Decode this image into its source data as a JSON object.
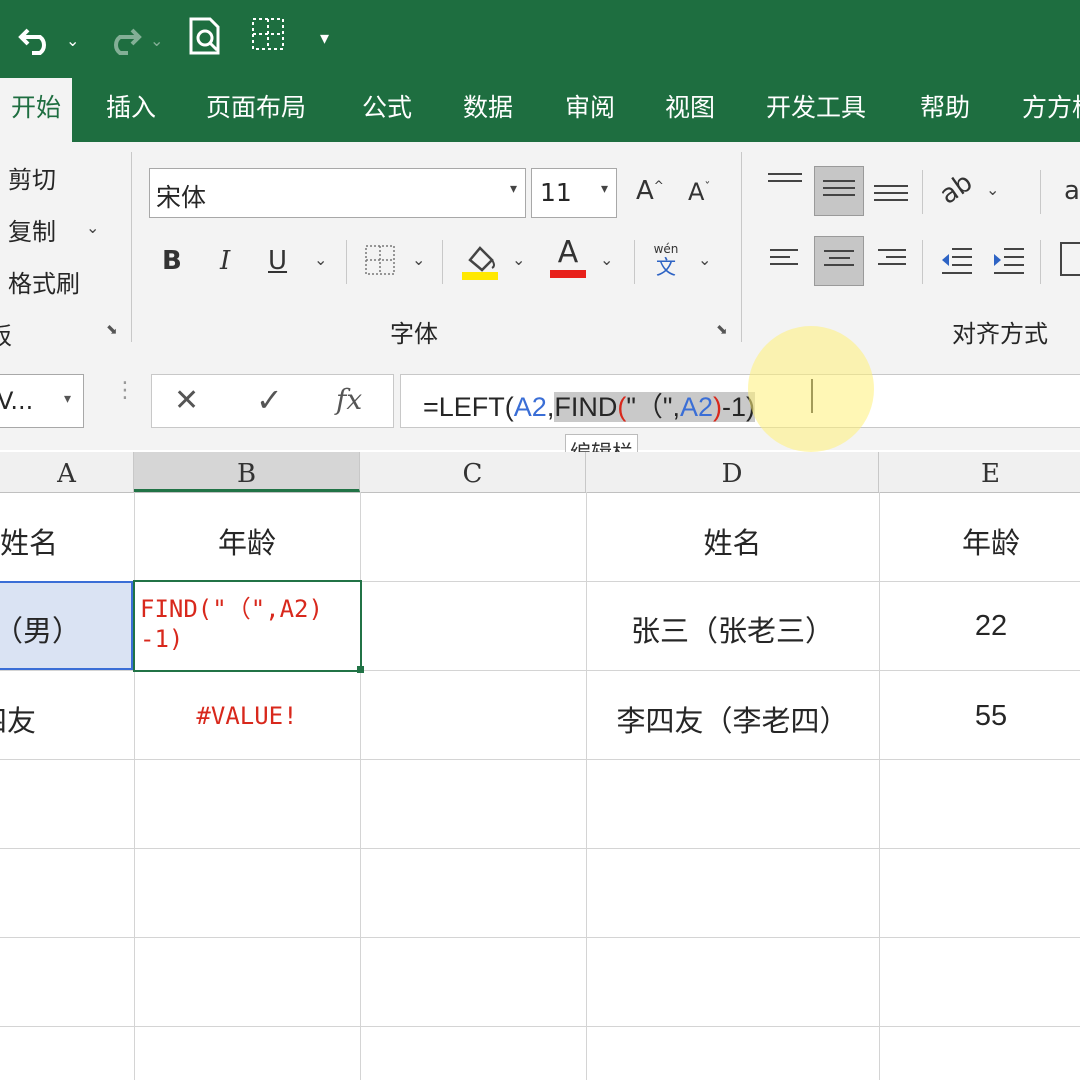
{
  "quick_access": {
    "undo_icon": "undo-icon",
    "redo_icon": "redo-icon",
    "print_preview_icon": "print-preview-icon",
    "borders_icon": "borders-icon",
    "customize_icon": "customize-quick-access-icon"
  },
  "tabs": [
    {
      "label": "开始",
      "active": true
    },
    {
      "label": "插入"
    },
    {
      "label": "页面布局"
    },
    {
      "label": "公式"
    },
    {
      "label": "数据"
    },
    {
      "label": "审阅"
    },
    {
      "label": "视图"
    },
    {
      "label": "开发工具"
    },
    {
      "label": "帮助"
    },
    {
      "label": "方方格"
    }
  ],
  "clipboard": {
    "cut": "剪切",
    "copy": "复制",
    "format_painter": "格式刷",
    "group_label_fragment": "板"
  },
  "font": {
    "name": "宋体",
    "size": "11",
    "grow_label": "A",
    "shrink_label": "A",
    "bold": "B",
    "italic": "I",
    "underline": "U",
    "font_color_label": "A",
    "phonetic_top": "wén",
    "phonetic_bottom": "文",
    "group_label": "字体",
    "fill_color": "#ffe800",
    "font_color": "#e8201a"
  },
  "alignment": {
    "group_label": "对齐方式",
    "wrap_fragment": "a"
  },
  "formula_bar": {
    "name_box": "V...",
    "cancel": "✕",
    "enter": "✓",
    "fx": "fx",
    "formula_parts": [
      {
        "text": "=LEFT(",
        "color": "#262626",
        "highlight": false
      },
      {
        "text": "A2",
        "color": "#3a6ed6",
        "highlight": false
      },
      {
        "text": ",",
        "color": "#262626",
        "highlight": false
      },
      {
        "text": "FIND",
        "color": "#262626",
        "highlight": true
      },
      {
        "text": "(",
        "color": "#d8281c",
        "highlight": true
      },
      {
        "text": "\"（\",",
        "color": "#262626",
        "highlight": true
      },
      {
        "text": "A2",
        "color": "#3a6ed6",
        "highlight": true
      },
      {
        "text": ")",
        "color": "#d8281c",
        "highlight": true
      },
      {
        "text": "-1)",
        "color": "#262626",
        "highlight": true
      }
    ],
    "tooltip": "编辑栏"
  },
  "columns": [
    "A",
    "B",
    "C",
    "D",
    "E"
  ],
  "cells": {
    "A1": "姓名",
    "B1": "年龄",
    "A2": "（男）",
    "B2_line1": "FIND(\"（\",A2)",
    "B2_line2": "-1)",
    "A3": "四友",
    "B3": "#VALUE!",
    "D1": "姓名",
    "E1": "年龄",
    "D2": "张三（张老三）",
    "E2": "22",
    "D3": "李四友（李老四）",
    "E3": "55"
  }
}
